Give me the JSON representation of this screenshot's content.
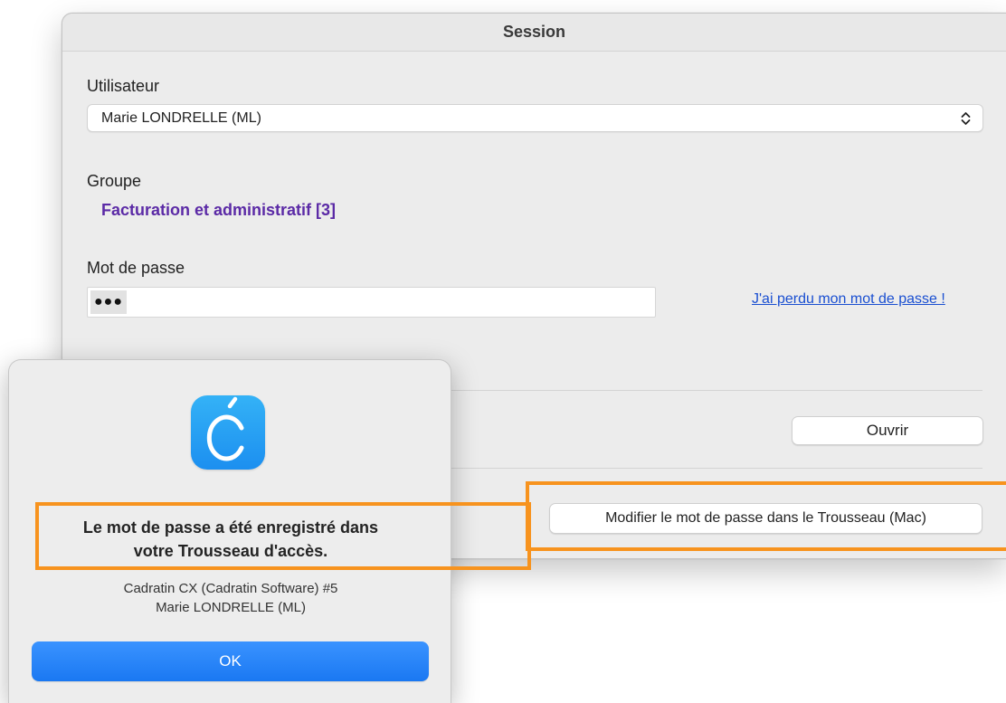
{
  "session_window": {
    "title": "Session",
    "user": {
      "label": "Utilisateur",
      "selected_value": "Marie LONDRELLE (ML)"
    },
    "group": {
      "label": "Groupe",
      "value": "Facturation et administratif [3]"
    },
    "password": {
      "label": "Mot de passe",
      "masked_value": "●●●",
      "lost_link": "J'ai perdu mon mot de passe !"
    },
    "open_button": "Ouvrir",
    "keychain_button": "Modifier le mot de passe dans le Trousseau (Mac)"
  },
  "alert": {
    "app_icon": "cadratin-app-icon",
    "title_line1": "Le mot de passe a été enregistré dans",
    "title_line2": "votre Trousseau d'accès.",
    "info_line1": "Cadratin CX (Cadratin Software) #5",
    "info_line2": "Marie LONDRELLE (ML)",
    "ok_button": "OK"
  },
  "colors": {
    "highlight": "#f7931e",
    "accent_blue": "#1a78f2",
    "group_text": "#5b2aa6",
    "link": "#1a4fd1",
    "app_icon": "#1c8ff0"
  }
}
